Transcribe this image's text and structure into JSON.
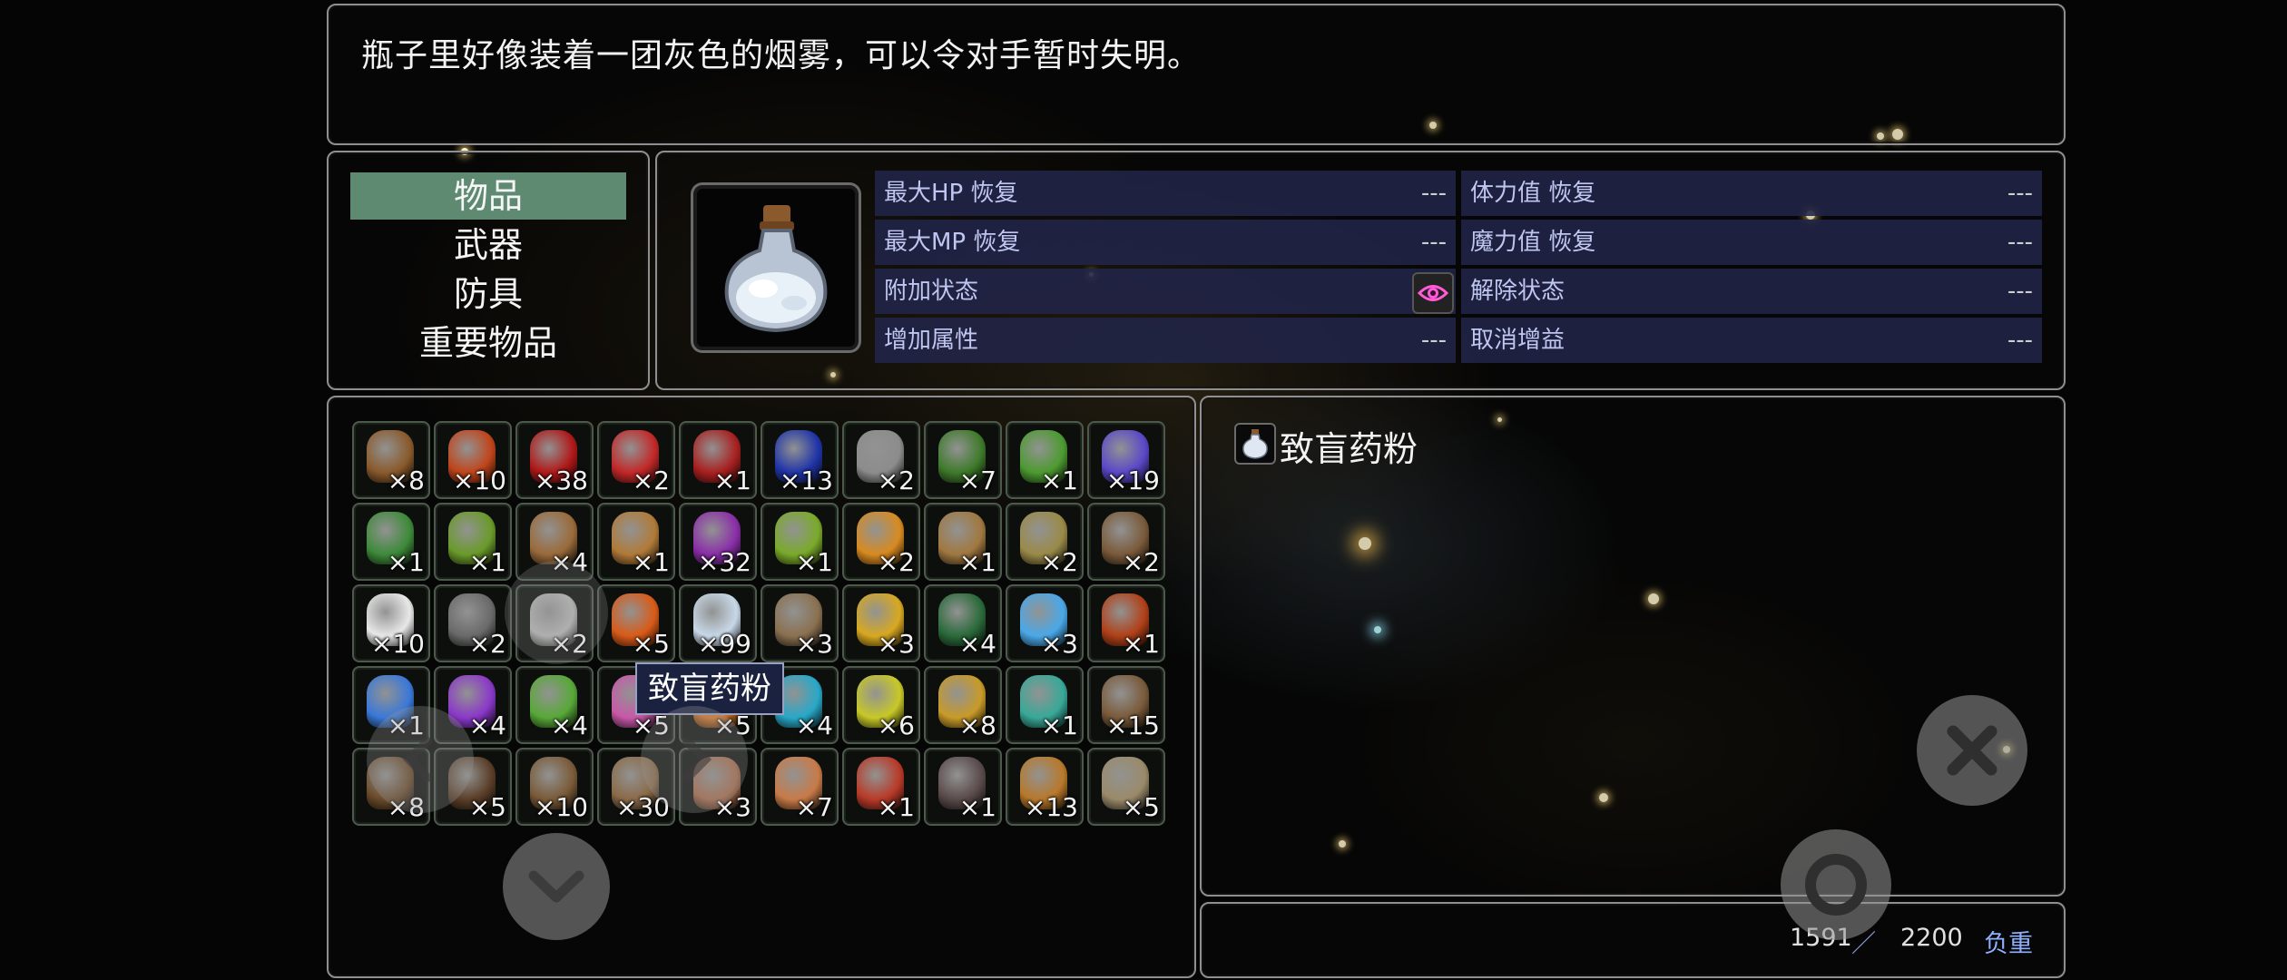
{
  "description": "瓶子里好像装着一团灰色的烟雾，可以令对手暂时失明。",
  "categories": [
    {
      "label": "物品",
      "selected": true
    },
    {
      "label": "武器",
      "selected": false
    },
    {
      "label": "防具",
      "selected": false
    },
    {
      "label": "重要物品",
      "selected": false
    }
  ],
  "selected_item": {
    "name": "致盲药粉",
    "icon": "white-powder-bottle-icon"
  },
  "stats": {
    "max_hp": {
      "label": "最大HP 恢复",
      "value": "---"
    },
    "stamina": {
      "label": "体力值 恢复",
      "value": "---"
    },
    "max_mp": {
      "label": "最大MP 恢复",
      "value": "---"
    },
    "mana": {
      "label": "魔力值 恢复",
      "value": "---"
    },
    "add_state": {
      "label": "附加状态",
      "value": "",
      "icon": "blind-eye-icon"
    },
    "remove_state": {
      "label": "解除状态",
      "value": "---"
    },
    "add_param": {
      "label": "增加属性",
      "value": "---"
    },
    "remove_buff": {
      "label": "取消增益",
      "value": "---"
    }
  },
  "inventory": [
    {
      "icon": "treasure-chest-icon",
      "qty": "×8",
      "color": "#8a5a2c"
    },
    {
      "icon": "orange-potion-icon",
      "qty": "×10",
      "color": "#c0441a"
    },
    {
      "icon": "red-potion-icon",
      "qty": "×38",
      "color": "#b01818"
    },
    {
      "icon": "red-potion-icon",
      "qty": "×2",
      "color": "#c22828"
    },
    {
      "icon": "red-potion-icon",
      "qty": "×1",
      "color": "#a82020"
    },
    {
      "icon": "blue-potion-icon",
      "qty": "×13",
      "color": "#2034a8"
    },
    {
      "icon": "grey-potion-icon",
      "qty": "×2",
      "color": "#8c8c8c"
    },
    {
      "icon": "herb-sprout-icon",
      "qty": "×7",
      "color": "#3e7a2a"
    },
    {
      "icon": "green-leaf-icon",
      "qty": "×1",
      "color": "#4c9a30"
    },
    {
      "icon": "blue-flower-icon",
      "qty": "×19",
      "color": "#5a48c8"
    },
    {
      "icon": "green-plant-icon",
      "qty": "×1",
      "color": "#3e8a3a"
    },
    {
      "icon": "vine-icon",
      "qty": "×1",
      "color": "#6a9a2a"
    },
    {
      "icon": "horn-icon",
      "qty": "×4",
      "color": "#9a6a3a"
    },
    {
      "icon": "bread-icon",
      "qty": "×1",
      "color": "#b07a38"
    },
    {
      "icon": "purple-fruit-icon",
      "qty": "×32",
      "color": "#8a2ea8"
    },
    {
      "icon": "green-fruit-icon",
      "qty": "×1",
      "color": "#7aaa2a"
    },
    {
      "icon": "orange-fruit-icon",
      "qty": "×2",
      "color": "#d88a20"
    },
    {
      "icon": "rope-coil-icon",
      "qty": "×1",
      "color": "#a07840"
    },
    {
      "icon": "hay-bundle-icon",
      "qty": "×2",
      "color": "#9a8a48"
    },
    {
      "icon": "wooden-bucket-icon",
      "qty": "×2",
      "color": "#7a5a3a"
    },
    {
      "icon": "white-powder-icon",
      "qty": "×10",
      "color": "#e8e8e8"
    },
    {
      "icon": "small-bottle-icon",
      "qty": "×2",
      "color": "#6a6a6a"
    },
    {
      "icon": "silver-ore-icon",
      "qty": "×2",
      "color": "#b8b8b8"
    },
    {
      "icon": "torch-icon",
      "qty": "×5",
      "color": "#d85a18"
    },
    {
      "icon": "white-powder-bottle-icon",
      "qty": "×99",
      "color": "#c8d8e8"
    },
    {
      "icon": "scroll-tube-icon",
      "qty": "×3",
      "color": "#8a7050"
    },
    {
      "icon": "gold-pile-icon",
      "qty": "×3",
      "color": "#d8a820"
    },
    {
      "icon": "green-gem-cluster-icon",
      "qty": "×4",
      "color": "#2a6a3a"
    },
    {
      "icon": "blue-crystal-icon",
      "qty": "×3",
      "color": "#4aa8e8"
    },
    {
      "icon": "red-rune-stone-icon",
      "qty": "×1",
      "color": "#b04018"
    },
    {
      "icon": "blue-rune-stone-icon",
      "qty": "×1",
      "color": "#3a78d8"
    },
    {
      "icon": "purple-rune-stone-icon",
      "qty": "×4",
      "color": "#8a38c8"
    },
    {
      "icon": "green-rune-stone-icon",
      "qty": "×4",
      "color": "#58a838"
    },
    {
      "icon": "pink-rune-stone-icon",
      "qty": "×5",
      "color": "#c858a8"
    },
    {
      "icon": "orange-rune-stone-icon",
      "qty": "×5",
      "color": "#d87828"
    },
    {
      "icon": "cyan-rune-stone-icon",
      "qty": "×4",
      "color": "#28a8c8"
    },
    {
      "icon": "yellow-rune-stone-icon",
      "qty": "×6",
      "color": "#c8c828"
    },
    {
      "icon": "gold-nugget-icon",
      "qty": "×8",
      "color": "#c89a28"
    },
    {
      "icon": "teal-crystal-icon",
      "qty": "×1",
      "color": "#38a898"
    },
    {
      "icon": "pickaxe-icon",
      "qty": "×15",
      "color": "#7a5a3a"
    },
    {
      "icon": "stick-icon",
      "qty": "×8",
      "color": "#6a4a2a"
    },
    {
      "icon": "bark-icon",
      "qty": "×5",
      "color": "#5a3e28"
    },
    {
      "icon": "wood-log-icon",
      "qty": "×10",
      "color": "#7a5a38"
    },
    {
      "icon": "wood-plank-icon",
      "qty": "×30",
      "color": "#8a6a48"
    },
    {
      "icon": "meat-icon",
      "qty": "×3",
      "color": "#a86a4a"
    },
    {
      "icon": "mushroom-icon",
      "qty": "×7",
      "color": "#c87a48"
    },
    {
      "icon": "raw-meat-icon",
      "qty": "×1",
      "color": "#b83a28"
    },
    {
      "icon": "coal-ore-icon",
      "qty": "×1",
      "color": "#5a4a4a"
    },
    {
      "icon": "roasted-fish-icon",
      "qty": "×13",
      "color": "#b8782a"
    },
    {
      "icon": "feather-icon",
      "qty": "×5",
      "color": "#9a8a6a"
    }
  ],
  "tooltip": "致盲药粉",
  "weight": {
    "current": "1591",
    "separator": "／",
    "max": "2200",
    "label": "负重"
  },
  "buttons": {
    "close": "close-x-icon",
    "confirm": "confirm-ring-icon",
    "scroll_down": "chevron-down-icon",
    "prev": "chevron-left-icon",
    "next": "chevron-right-icon"
  }
}
